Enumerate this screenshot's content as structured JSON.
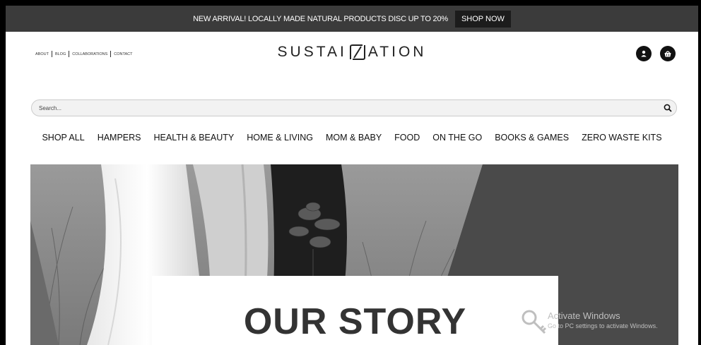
{
  "promo": {
    "text": "NEW ARRIVAL! LOCALLY MADE NATURAL PRODUCTS DISC UP TO 20%",
    "button": "SHOP NOW"
  },
  "top_links": [
    "ABOUT",
    "BLOG",
    "COLLABORATIONS",
    "CONTACT"
  ],
  "logo": {
    "left": "SUSTAI",
    "right": "ATION"
  },
  "icons": {
    "account": "user-icon",
    "cart": "basket-icon",
    "search": "search-icon"
  },
  "search": {
    "placeholder": "Search..."
  },
  "nav": [
    "SHOP ALL",
    "HAMPERS",
    "HEALTH & BEAUTY",
    "HOME & LIVING",
    "MOM & BABY",
    "FOOD",
    "ON THE GO",
    "BOOKS & GAMES",
    "ZERO WASTE KITS"
  ],
  "hero": {
    "title": "OUR STORY"
  },
  "watermark": {
    "title": "Activate Windows",
    "subtitle": "Go to PC settings to activate Windows."
  },
  "colors": {
    "promo_bg": "#3b3b3b",
    "button_bg": "#1c1c1c",
    "hero_dark": "#4a4a4a"
  }
}
